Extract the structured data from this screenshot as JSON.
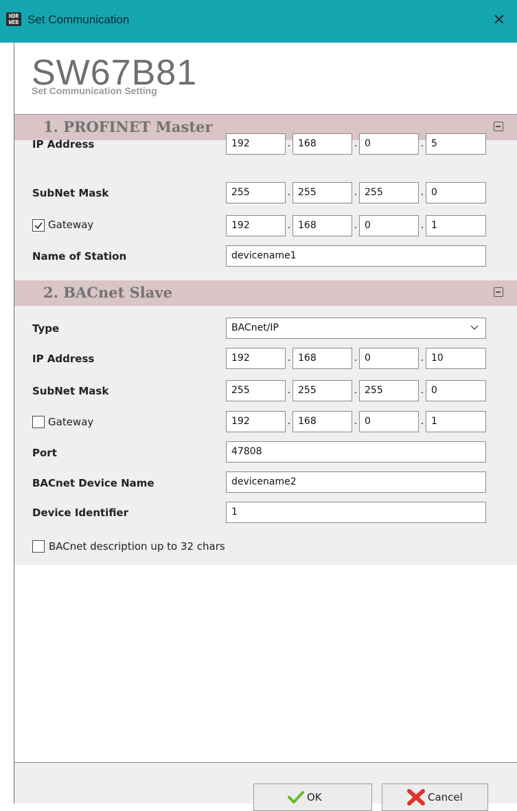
{
  "window": {
    "title": "Set Communication",
    "close_glyph": "✕",
    "app_icon_text": "HDR WEB"
  },
  "header": {
    "model": "SW67B81",
    "subtitle": "Set Communication Setting"
  },
  "profinet": {
    "title": "1. PROFINET Master",
    "ip_label": "IP Address",
    "ip": [
      "192",
      "168",
      "0",
      "5"
    ],
    "subnet_label": "SubNet Mask",
    "subnet": [
      "255",
      "255",
      "255",
      "0"
    ],
    "gateway_label": "Gateway",
    "gateway_checked": true,
    "gateway": [
      "192",
      "168",
      "0",
      "1"
    ],
    "station_label": "Name of Station",
    "station": "devicename1"
  },
  "bacnet": {
    "title": "2. BACnet Slave",
    "type_label": "Type",
    "type_value": "BACnet/IP",
    "ip_label": "IP Address",
    "ip": [
      "192",
      "168",
      "0",
      "10"
    ],
    "subnet_label": "SubNet Mask",
    "subnet": [
      "255",
      "255",
      "255",
      "0"
    ],
    "gateway_label": "Gateway",
    "gateway_checked": false,
    "gateway": [
      "192",
      "168",
      "0",
      "1"
    ],
    "port_label": "Port",
    "port": "47808",
    "device_name_label": "BACnet Device Name",
    "device_name": "devicename2",
    "device_id_label": "Device Identifier",
    "device_id": "1",
    "desc_label": "BACnet description up to 32 chars",
    "desc_checked": false
  },
  "buttons": {
    "ok": "OK",
    "cancel": "Cancel"
  },
  "colors": {
    "titlebar": "#14a6b1",
    "section_header": "#d9c4c7",
    "form_bg": "#efefef",
    "ok_check": "#6ab82e",
    "cancel_x": "#e0332b"
  },
  "icons": {
    "app": "hdr-web-app-icon",
    "close": "close-icon",
    "collapse": "collapse-minus-icon",
    "ok": "green-check-icon",
    "cancel": "red-x-icon",
    "dropdown": "chevron-down-icon"
  }
}
